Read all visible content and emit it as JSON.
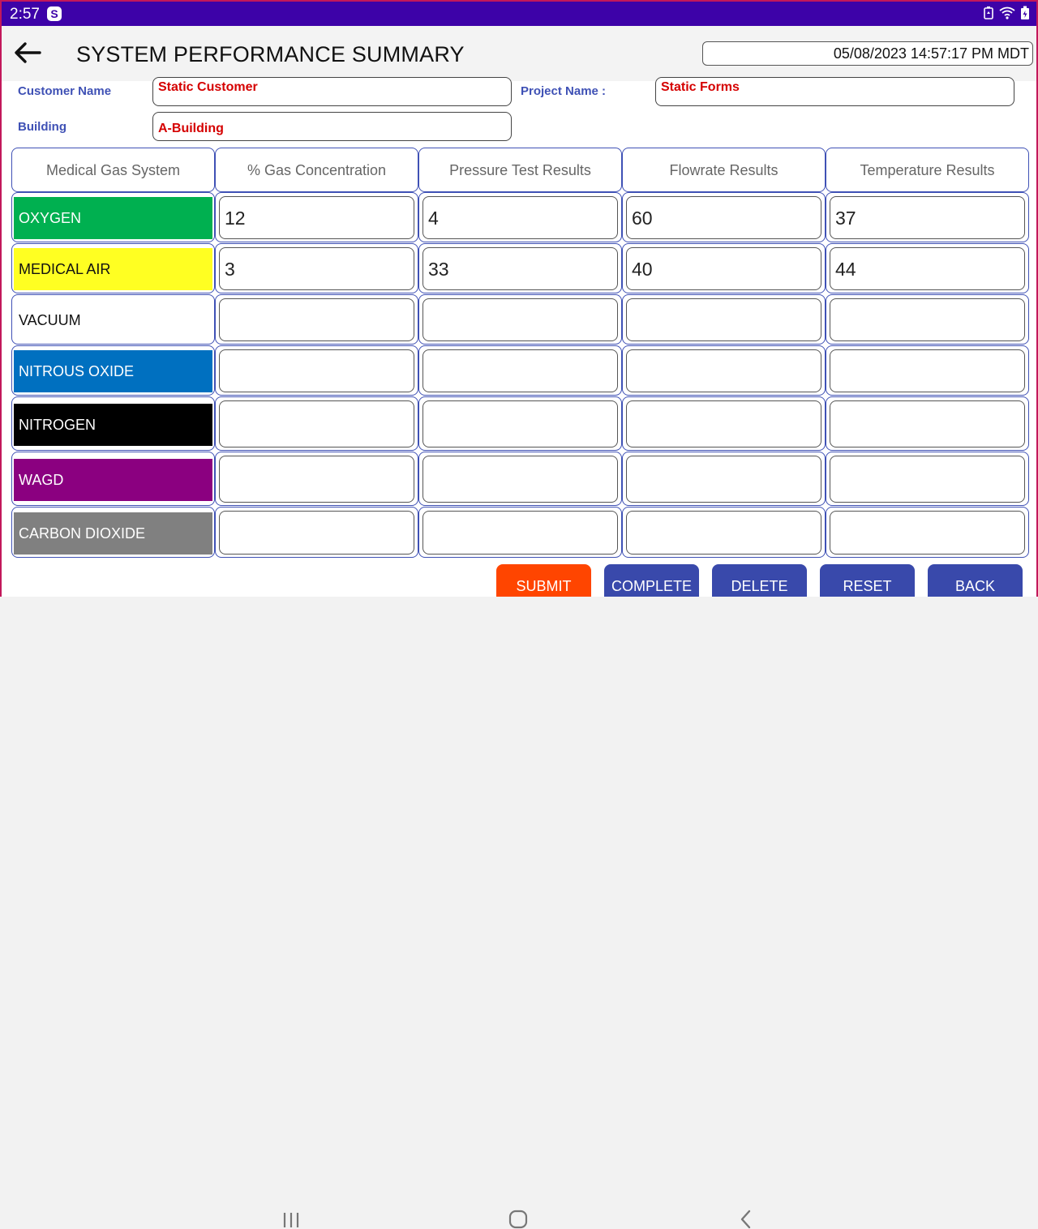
{
  "status_bar": {
    "time": "2:57",
    "app_badge": "S"
  },
  "header": {
    "title": "SYSTEM PERFORMANCE SUMMARY",
    "datetime": "05/08/2023 14:57:17 PM MDT"
  },
  "form": {
    "customer_label": "Customer Name",
    "customer_value": "Static Customer",
    "project_label": "Project Name :",
    "project_value": "Static Forms",
    "building_label": "Building",
    "building_value": "A-Building"
  },
  "table": {
    "headers": [
      "Medical Gas System",
      "% Gas Concentration",
      "Pressure Test Results",
      "Flowrate Results",
      "Temperature Results"
    ],
    "rows": [
      {
        "name": "OXYGEN",
        "bg": "#00b050",
        "fg": "#ffffff",
        "values": [
          "12",
          "4",
          "60",
          "37"
        ]
      },
      {
        "name": "MEDICAL AIR",
        "bg": "#ffff22",
        "fg": "#111111",
        "values": [
          "3",
          "33",
          "40",
          "44"
        ]
      },
      {
        "name": "VACUUM",
        "bg": "#ffffff",
        "fg": "#111111",
        "values": [
          "",
          "",
          "",
          ""
        ]
      },
      {
        "name": "NITROUS OXIDE",
        "bg": "#0070c0",
        "fg": "#ffffff",
        "values": [
          "",
          "",
          "",
          ""
        ]
      },
      {
        "name": "NITROGEN",
        "bg": "#000000",
        "fg": "#ffffff",
        "values": [
          "",
          "",
          "",
          ""
        ]
      },
      {
        "name": "WAGD",
        "bg": "#8b0080",
        "fg": "#ffffff",
        "values": [
          "",
          "",
          "",
          ""
        ]
      },
      {
        "name": "CARBON DIOXIDE",
        "bg": "#808080",
        "fg": "#ffffff",
        "values": [
          "",
          "",
          "",
          ""
        ]
      }
    ]
  },
  "buttons": {
    "submit": "SUBMIT",
    "complete": "COMPLETE",
    "delete": "DELETE",
    "reset": "RESET",
    "back": "BACK"
  },
  "colors": {
    "submit": "#ff4500",
    "action": "#3949ab",
    "label": "#3f51b5",
    "value": "#d50000",
    "status_bar": "#3d02a8"
  }
}
